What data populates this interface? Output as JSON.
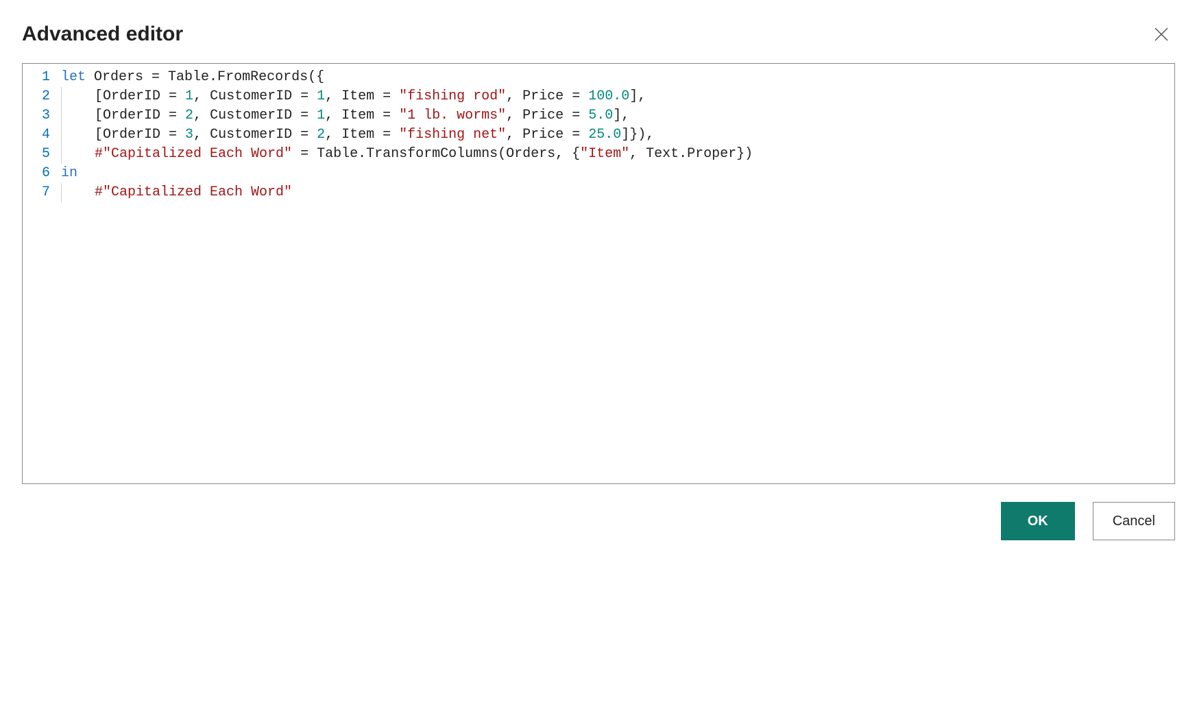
{
  "title": "Advanced editor",
  "buttons": {
    "ok": "OK",
    "cancel": "Cancel"
  },
  "code": {
    "lines": [
      {
        "n": "1",
        "indent": 0,
        "tokens": [
          {
            "t": "kw",
            "v": "let"
          },
          {
            "t": "punc",
            "v": " "
          },
          {
            "t": "id",
            "v": "Orders = Table.FromRecords({"
          }
        ]
      },
      {
        "n": "2",
        "indent": 1,
        "tokens": [
          {
            "t": "id",
            "v": "[OrderID = "
          },
          {
            "t": "num",
            "v": "1"
          },
          {
            "t": "id",
            "v": ", CustomerID = "
          },
          {
            "t": "num",
            "v": "1"
          },
          {
            "t": "id",
            "v": ", Item = "
          },
          {
            "t": "str",
            "v": "\"fishing rod\""
          },
          {
            "t": "id",
            "v": ", Price = "
          },
          {
            "t": "num",
            "v": "100.0"
          },
          {
            "t": "id",
            "v": "],"
          }
        ]
      },
      {
        "n": "3",
        "indent": 1,
        "tokens": [
          {
            "t": "id",
            "v": "[OrderID = "
          },
          {
            "t": "num",
            "v": "2"
          },
          {
            "t": "id",
            "v": ", CustomerID = "
          },
          {
            "t": "num",
            "v": "1"
          },
          {
            "t": "id",
            "v": ", Item = "
          },
          {
            "t": "str",
            "v": "\"1 lb. worms\""
          },
          {
            "t": "id",
            "v": ", Price = "
          },
          {
            "t": "num",
            "v": "5.0"
          },
          {
            "t": "id",
            "v": "],"
          }
        ]
      },
      {
        "n": "4",
        "indent": 1,
        "tokens": [
          {
            "t": "id",
            "v": "[OrderID = "
          },
          {
            "t": "num",
            "v": "3"
          },
          {
            "t": "id",
            "v": ", CustomerID = "
          },
          {
            "t": "num",
            "v": "2"
          },
          {
            "t": "id",
            "v": ", Item = "
          },
          {
            "t": "str",
            "v": "\"fishing net\""
          },
          {
            "t": "id",
            "v": ", Price = "
          },
          {
            "t": "num",
            "v": "25.0"
          },
          {
            "t": "id",
            "v": "]}),"
          }
        ]
      },
      {
        "n": "5",
        "indent": 1,
        "tokens": [
          {
            "t": "str",
            "v": "#\"Capitalized Each Word\""
          },
          {
            "t": "id",
            "v": " = Table.TransformColumns(Orders, {"
          },
          {
            "t": "str",
            "v": "\"Item\""
          },
          {
            "t": "id",
            "v": ", Text.Proper})"
          }
        ]
      },
      {
        "n": "6",
        "indent": 0,
        "tokens": [
          {
            "t": "kw",
            "v": "in"
          }
        ]
      },
      {
        "n": "7",
        "indent": 1,
        "tokens": [
          {
            "t": "str",
            "v": "#\"Capitalized Each Word\""
          }
        ]
      }
    ]
  }
}
